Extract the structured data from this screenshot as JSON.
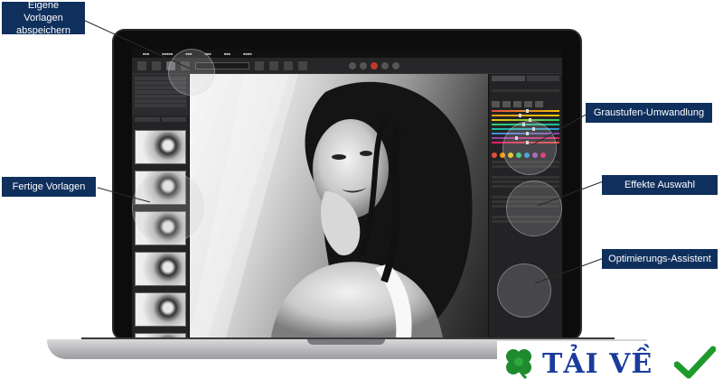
{
  "callouts": {
    "custom_presets": "Eigene Vorlagen\nabspeichern",
    "ready_presets": "Fertige Vorlagen",
    "grayscale_conversion": "Graustufen-Umwandlung",
    "effects_selection": "Effekte Auswahl",
    "optimization_assistant": "Optimierungs-Assistent"
  },
  "badge": {
    "text": "TẢI VỀ",
    "text_color": "#1a3b9c",
    "clover_color": "#1f8a2e",
    "check_color": "#1e9a2c"
  },
  "colors": {
    "callout_bg": "#0f2f5c",
    "callout_text": "#ffffff"
  },
  "icons": [
    "clover-icon",
    "checkmark-icon"
  ]
}
